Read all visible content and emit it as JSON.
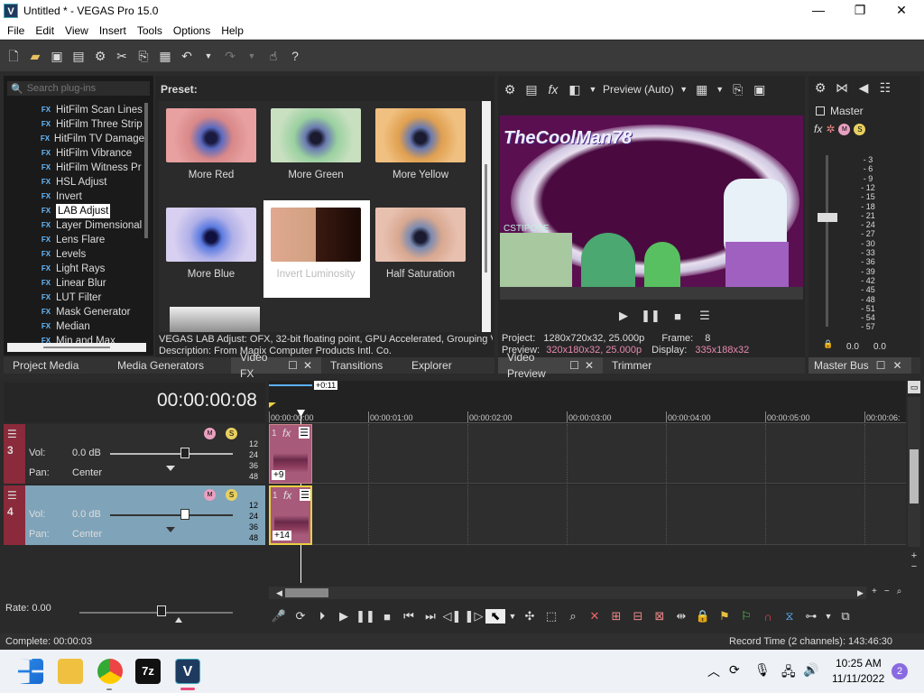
{
  "window": {
    "title": "Untitled * - VEGAS Pro 15.0",
    "logo_letter": "V",
    "minimize": "—",
    "maximize": "❐",
    "close": "✕"
  },
  "menu": [
    "File",
    "Edit",
    "View",
    "Insert",
    "Tools",
    "Options",
    "Help"
  ],
  "plugins": {
    "search_placeholder": "Search plug-ins",
    "items": [
      {
        "label": "HitFilm Scan Lines",
        "selected": false
      },
      {
        "label": "HitFilm Three Strip",
        "selected": false
      },
      {
        "label": "HitFilm TV Damage",
        "selected": false
      },
      {
        "label": "HitFilm Vibrance",
        "selected": false
      },
      {
        "label": "HitFilm Witness Pr",
        "selected": false
      },
      {
        "label": "HSL Adjust",
        "selected": false
      },
      {
        "label": "Invert",
        "selected": false
      },
      {
        "label": "LAB Adjust",
        "selected": true
      },
      {
        "label": "Layer Dimensional",
        "selected": false
      },
      {
        "label": "Lens Flare",
        "selected": false
      },
      {
        "label": "Levels",
        "selected": false
      },
      {
        "label": "Light Rays",
        "selected": false
      },
      {
        "label": "Linear Blur",
        "selected": false
      },
      {
        "label": "LUT Filter",
        "selected": false
      },
      {
        "label": "Mask Generator",
        "selected": false
      },
      {
        "label": "Median",
        "selected": false
      },
      {
        "label": "Min and Max",
        "selected": false
      }
    ],
    "badge": "FX"
  },
  "presets": {
    "header": "Preset:",
    "items": [
      {
        "label": "More Red",
        "color": "#e87070"
      },
      {
        "label": "More Green",
        "color": "#7fcf8a"
      },
      {
        "label": "More Yellow",
        "color": "#e8a44a"
      },
      {
        "label": "More Blue",
        "color": "#8aa0e8"
      },
      {
        "label": "Invert Luminosity",
        "color": "#7a4a2a"
      },
      {
        "label": "Half Saturation",
        "color": "#d9a58a"
      }
    ],
    "description_line1": "VEGAS LAB Adjust: OFX, 32-bit floating point, GPU Accelerated, Grouping VE",
    "description_line2": "Description: From Magix Computer Products Intl. Co."
  },
  "left_tabs": [
    "Project Media",
    "Media Generators",
    "Video FX",
    "Transitions",
    "Explorer"
  ],
  "preview": {
    "mode": "Preview (Auto)",
    "overlay_title": "TheCoolMan78",
    "overlay_small": "CSTIPOSE 4SUND",
    "project_label": "Project:",
    "project_value": "1280x720x32, 25.000p",
    "frame_label": "Frame:",
    "frame_value": "8",
    "preview_label": "Preview:",
    "preview_value": "320x180x32, 25.000p",
    "display_label": "Display:",
    "display_value": "335x188x32",
    "tabs": [
      "Video Preview",
      "Trimmer"
    ]
  },
  "master": {
    "label": "Master",
    "scale": [
      "3",
      "6",
      "9",
      "12",
      "15",
      "18",
      "21",
      "24",
      "27",
      "30",
      "33",
      "36",
      "39",
      "42",
      "45",
      "48",
      "51",
      "54",
      "57"
    ],
    "level_left": "0.0",
    "level_right": "0.0",
    "tab": "Master Bus"
  },
  "timeline": {
    "timecode": "00:00:00:08",
    "offset": "+0:11",
    "ruler": [
      "00:00:00:00",
      "00:00:01:00",
      "00:00:02:00",
      "00:00:03:00",
      "00:00:04:00",
      "00:00:05:00",
      "00:00:06:"
    ],
    "tracks": [
      {
        "number": "3",
        "vol_label": "Vol:",
        "vol_value": "0.0 dB",
        "pan_label": "Pan:",
        "pan_value": "Center",
        "event_num": "1",
        "count": "+9",
        "scale": [
          "12",
          "24",
          "36",
          "48"
        ]
      },
      {
        "number": "4",
        "vol_label": "Vol:",
        "vol_value": "0.0 dB",
        "pan_label": "Pan:",
        "pan_value": "Center",
        "event_num": "1",
        "count": "+14",
        "scale": [
          "12",
          "24",
          "36",
          "48"
        ]
      }
    ],
    "rate_label": "Rate: 0.00"
  },
  "status": {
    "left": "Complete: 00:00:03",
    "right": "Record Time (2 channels): 143:46:30"
  },
  "taskbar": {
    "time": "10:25 AM",
    "date": "11/11/2022",
    "notification_count": "2",
    "sevenzip": "7z",
    "vegas": "V"
  },
  "colors": {
    "accent_blue": "#5ab0ff",
    "track_red": "#8a2a3a",
    "event_magenta": "#a85a7a",
    "selected_track": "#7fa3b8"
  }
}
